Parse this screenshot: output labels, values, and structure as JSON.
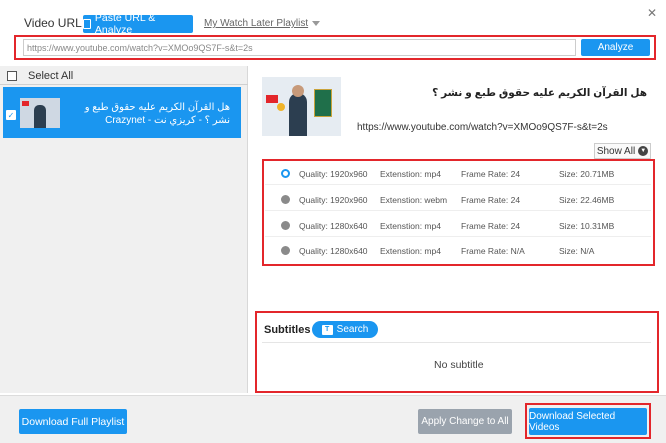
{
  "header": {
    "video_url_label": "Video URL:",
    "paste_button": "Paste URL & Analyze",
    "watch_later_link": "My Watch Later Playlist",
    "close_glyph": "✕"
  },
  "url_bar": {
    "value": "https://www.youtube.com/watch?v=XMOo9QS7F-s&t=2s",
    "analyze_button": "Analyze"
  },
  "left_panel": {
    "select_all": "Select All",
    "items": [
      {
        "title": "هل القرآن الكريم عليه حقوق طبع و نشر ؟ - كريزي نت - Crazynet"
      }
    ]
  },
  "video": {
    "title": "هل القرآن الكريم عليه حقوق طبع و نشر ؟",
    "url": "https://www.youtube.com/watch?v=XMOo9QS7F-s&t=2s",
    "show_all": "Show All"
  },
  "formats": [
    {
      "quality": "Quality: 1920x960",
      "extension": "Extenstion: mp4",
      "frame_rate": "Frame Rate: 24",
      "size": "Size: 20.71MB",
      "selected": true
    },
    {
      "quality": "Quality: 1920x960",
      "extension": "Extenstion: webm",
      "frame_rate": "Frame Rate: 24",
      "size": "Size: 22.46MB",
      "selected": false
    },
    {
      "quality": "Quality: 1280x640",
      "extension": "Extenstion: mp4",
      "frame_rate": "Frame Rate: 24",
      "size": "Size: 10.31MB",
      "selected": false
    },
    {
      "quality": "Quality: 1280x640",
      "extension": "Extenstion: mp4",
      "frame_rate": "Frame Rate: N/A",
      "size": "Size: N/A",
      "selected": false
    }
  ],
  "subtitles": {
    "label": "Subtitles",
    "search_button": "Search",
    "empty_text": "No subtitle"
  },
  "footer": {
    "download_playlist": "Download Full Playlist",
    "apply_change": "Apply Change to All",
    "download_selected": "Download Selected Videos"
  },
  "colors": {
    "accent": "#1a96f0",
    "highlight": "#e3262b",
    "panel_bg": "#f0f0f0"
  }
}
